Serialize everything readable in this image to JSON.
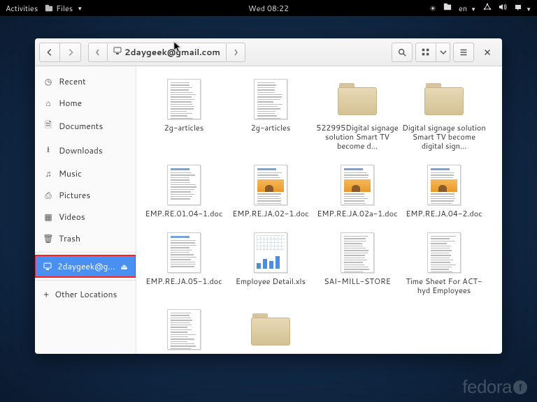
{
  "topbar": {
    "activities": "Activities",
    "app_label": "Files",
    "clock": "Wed 08:22",
    "lang": "en"
  },
  "window": {
    "path_label": "2daygeek@gmail.com"
  },
  "sidebar": {
    "items": [
      {
        "label": "Recent",
        "icon": "clock-icon"
      },
      {
        "label": "Home",
        "icon": "home-icon"
      },
      {
        "label": "Documents",
        "icon": "document-icon"
      },
      {
        "label": "Downloads",
        "icon": "download-icon"
      },
      {
        "label": "Music",
        "icon": "music-icon"
      },
      {
        "label": "Pictures",
        "icon": "pictures-icon"
      },
      {
        "label": "Videos",
        "icon": "videos-icon"
      },
      {
        "label": "Trash",
        "icon": "trash-icon"
      }
    ],
    "mount": {
      "label": "2daygeek@g…"
    },
    "other": "Other Locations"
  },
  "files": [
    {
      "type": "text",
      "label": "2g-articles"
    },
    {
      "type": "text",
      "label": "2g-articles"
    },
    {
      "type": "folder",
      "label": "522995Digital signage solution Smart TV become d…"
    },
    {
      "type": "folder",
      "label": "Digital signage solution Smart TV become digital sign…"
    },
    {
      "type": "doc",
      "label": "EMP.RE.01.04-1.doc"
    },
    {
      "type": "docimg",
      "label": "EMP.RE.JA.02-1.doc"
    },
    {
      "type": "docimg",
      "label": "EMP.RE.JA.02a-1.doc"
    },
    {
      "type": "docimg",
      "label": "EMP.RE.JA.04-2.doc"
    },
    {
      "type": "doc",
      "label": "EMP.RE.JA.05-1.doc"
    },
    {
      "type": "xls",
      "label": "Employee Detail.xls"
    },
    {
      "type": "text",
      "label": "SAI-MILL-STORE"
    },
    {
      "type": "text",
      "label": "Time Sheet For ACT-hyd Employees"
    },
    {
      "type": "text",
      "label": ""
    },
    {
      "type": "folder",
      "label": ""
    }
  ],
  "branding": {
    "distro": "fedora"
  }
}
